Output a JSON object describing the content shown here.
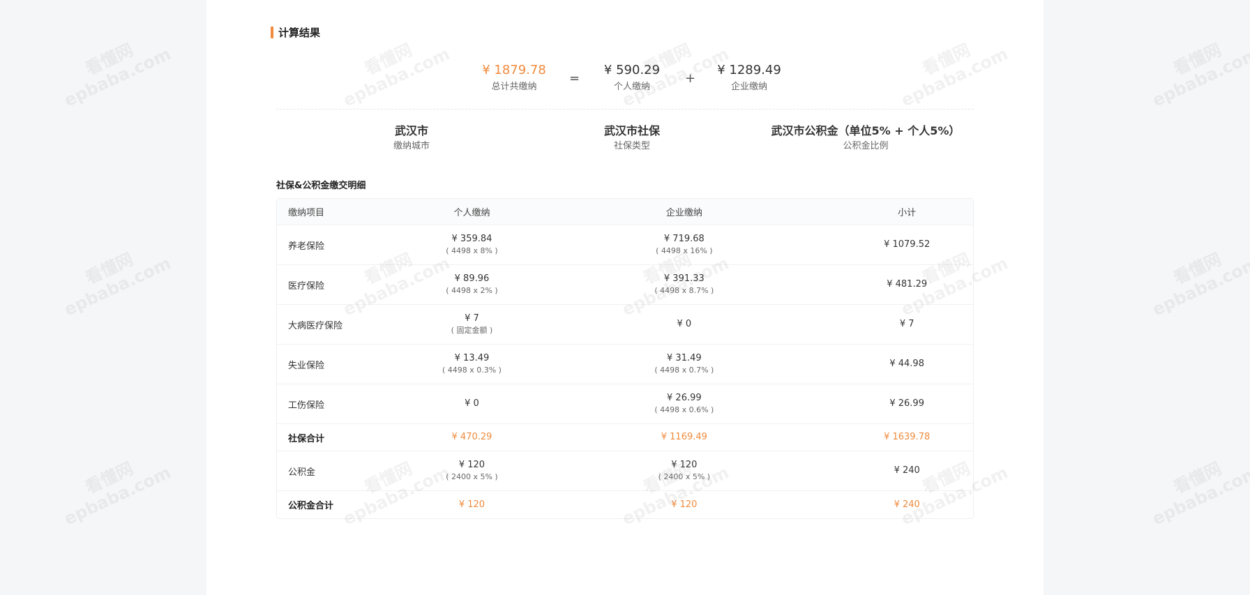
{
  "result": {
    "title": "计算结果",
    "total": {
      "value": "¥ 1879.78",
      "label": "总计共缴纳"
    },
    "equals": "=",
    "personal": {
      "value": "¥ 590.29",
      "label": "个人缴纳"
    },
    "plus": "+",
    "company": {
      "value": "¥ 1289.49",
      "label": "企业缴纳"
    }
  },
  "info": {
    "city": {
      "value": "武汉市",
      "label": "缴纳城市"
    },
    "type": {
      "value": "武汉市社保",
      "label": "社保类型"
    },
    "fund": {
      "value": "武汉市公积金（单位5% + 个人5%）",
      "label": "公积金比例"
    }
  },
  "detail": {
    "title": "社保&公积金缴交明细",
    "headers": [
      "缴纳项目",
      "个人缴纳",
      "企业缴纳",
      "小计"
    ],
    "rows": [
      {
        "name": "养老保险",
        "personal": "¥ 359.84",
        "personal_calc": "( 4498 x 8% )",
        "company": "¥ 719.68",
        "company_calc": "( 4498 x 16% )",
        "subtotal": "¥ 1079.52"
      },
      {
        "name": "医疗保险",
        "personal": "¥ 89.96",
        "personal_calc": "( 4498 x 2% )",
        "company": "¥ 391.33",
        "company_calc": "( 4498 x 8.7% )",
        "subtotal": "¥ 481.29"
      },
      {
        "name": "大病医疗保险",
        "personal": "¥ 7",
        "personal_calc": "( 固定金额 )",
        "company": "¥ 0",
        "company_calc": "",
        "subtotal": "¥ 7"
      },
      {
        "name": "失业保险",
        "personal": "¥ 13.49",
        "personal_calc": "( 4498 x 0.3% )",
        "company": "¥ 31.49",
        "company_calc": "( 4498 x 0.7% )",
        "subtotal": "¥ 44.98"
      },
      {
        "name": "工伤保险",
        "personal": "¥ 0",
        "personal_calc": "",
        "company": "¥ 26.99",
        "company_calc": "( 4498 x 0.6% )",
        "subtotal": "¥ 26.99"
      }
    ],
    "social_total": {
      "name": "社保合计",
      "personal": "¥ 470.29",
      "company": "¥ 1169.49",
      "subtotal": "¥ 1639.78"
    },
    "fund_row": {
      "name": "公积金",
      "personal": "¥ 120",
      "personal_calc": "( 2400 x 5% )",
      "company": "¥ 120",
      "company_calc": "( 2400 x 5% )",
      "subtotal": "¥ 240"
    },
    "fund_total": {
      "name": "公积金合计",
      "personal": "¥ 120",
      "company": "¥ 120",
      "subtotal": "¥ 240"
    }
  },
  "watermark": {
    "line1": "看懂网",
    "line2": "epbaba.com"
  },
  "colors": {
    "accent": "#f08a3c",
    "background": "#f5f6f8",
    "card": "#ffffff"
  }
}
